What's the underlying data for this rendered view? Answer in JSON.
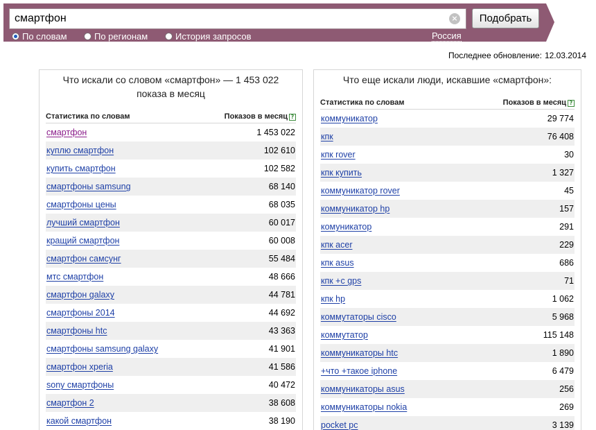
{
  "search": {
    "query": "смартфон",
    "submit_label": "Подобрать",
    "clear_symbol": "×",
    "modes": [
      {
        "label": "По словам",
        "selected": true
      },
      {
        "label": "По регионам",
        "selected": false
      },
      {
        "label": "История запросов",
        "selected": false
      }
    ],
    "region": "Россия",
    "bar_color": "#8e5a73"
  },
  "last_update": {
    "label": "Последнее обновление:",
    "date": "12.03.2014"
  },
  "left_panel": {
    "title": "Что искали со словом «смартфон» — 1 453 022 показа в месяц",
    "col_keyword": "Статистика по словам",
    "col_count": "Показов в месяц",
    "help_symbol": "?",
    "rows": [
      {
        "keyword": "смартфон",
        "count": "1 453 022",
        "visited": true
      },
      {
        "keyword": "куплю смартфон",
        "count": "102 610"
      },
      {
        "keyword": "купить смартфон",
        "count": "102 582"
      },
      {
        "keyword": "смартфоны samsung",
        "count": "68 140"
      },
      {
        "keyword": "смартфоны цены",
        "count": "68 035"
      },
      {
        "keyword": "лучший смартфон",
        "count": "60 017"
      },
      {
        "keyword": "кращий смартфон",
        "count": "60 008"
      },
      {
        "keyword": "смартфон самсунг",
        "count": "55 484"
      },
      {
        "keyword": "мтс смартфон",
        "count": "48 666"
      },
      {
        "keyword": "смартфон galaxy",
        "count": "44 781"
      },
      {
        "keyword": "смартфоны 2014",
        "count": "44 692"
      },
      {
        "keyword": "смартфоны htc",
        "count": "43 363"
      },
      {
        "keyword": "смартфоны samsung galaxy",
        "count": "41 901"
      },
      {
        "keyword": "смартфон xperia",
        "count": "41 586"
      },
      {
        "keyword": "sony смартфоны",
        "count": "40 472"
      },
      {
        "keyword": "смартфон 2",
        "count": "38 608"
      },
      {
        "keyword": "какой смартфон",
        "count": "38 190"
      }
    ]
  },
  "right_panel": {
    "title": "Что еще искали люди, искавшие «смартфон»:",
    "col_keyword": "Статистика по словам",
    "col_count": "Показов в месяц",
    "help_symbol": "?",
    "rows": [
      {
        "keyword": "коммуникатор",
        "count": "29 774"
      },
      {
        "keyword": "кпк",
        "count": "76 408"
      },
      {
        "keyword": "кпк rover",
        "count": "30"
      },
      {
        "keyword": "кпк купить",
        "count": "1 327"
      },
      {
        "keyword": "коммуникатор rover",
        "count": "45"
      },
      {
        "keyword": "коммуникатор hp",
        "count": "157"
      },
      {
        "keyword": "комуникатор",
        "count": "291"
      },
      {
        "keyword": "кпк acer",
        "count": "229"
      },
      {
        "keyword": "кпк asus",
        "count": "686"
      },
      {
        "keyword": "кпк +с gps",
        "count": "71"
      },
      {
        "keyword": "кпк hp",
        "count": "1 062"
      },
      {
        "keyword": "коммутаторы cisco",
        "count": "5 968"
      },
      {
        "keyword": "коммутатор",
        "count": "115 148"
      },
      {
        "keyword": "коммуникаторы htc",
        "count": "1 890"
      },
      {
        "keyword": "+что +такое iphone",
        "count": "6 479"
      },
      {
        "keyword": "коммуникаторы asus",
        "count": "256"
      },
      {
        "keyword": "коммуникаторы nokia",
        "count": "269"
      },
      {
        "keyword": "pocket pc",
        "count": "3 139"
      }
    ]
  }
}
